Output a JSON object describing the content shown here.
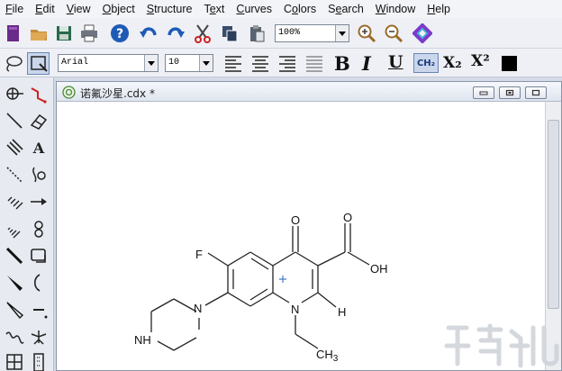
{
  "menu": {
    "items": [
      {
        "id": "file",
        "first": "F",
        "rest": "ile"
      },
      {
        "id": "edit",
        "first": "E",
        "rest": "dit"
      },
      {
        "id": "view",
        "first": "V",
        "rest": "iew"
      },
      {
        "id": "object",
        "first": "O",
        "rest": "bject"
      },
      {
        "id": "structure",
        "first": "S",
        "rest": "tructure"
      },
      {
        "id": "text",
        "first": "Te",
        "rest": "xt",
        "ulIndex": 1
      },
      {
        "id": "curves",
        "first": "C",
        "rest": "urves"
      },
      {
        "id": "colors",
        "first": "Co",
        "rest": "lors",
        "ulIndex": 1
      },
      {
        "id": "search",
        "first": "Se",
        "rest": "arch",
        "ulIndex": 1
      },
      {
        "id": "window",
        "first": "W",
        "rest": "indow"
      },
      {
        "id": "help",
        "first": "H",
        "rest": "elp"
      }
    ]
  },
  "toolbar": {
    "zoom_value": "100%",
    "font_value": "Arial",
    "size_value": "10",
    "bold_label": "B",
    "italic_label": "I",
    "underline_label": "U",
    "formula_label": "CH₂",
    "subscript_label": "X₂",
    "superscript_label": "X²"
  },
  "document": {
    "title": "诺氟沙星.cdx *"
  },
  "molecule": {
    "atoms": {
      "o_ketone": "O",
      "o_acid_top": "O",
      "oh": "OH",
      "f": "F",
      "n_ring": "N",
      "h": "H",
      "n_piperazine": "N",
      "nh": "NH",
      "ch": "CH",
      "ch_sub": "3"
    }
  },
  "colors": {
    "accent": "#2a5db0",
    "menubar": "#f3f4f8",
    "toolbar": "#eef0f5"
  }
}
